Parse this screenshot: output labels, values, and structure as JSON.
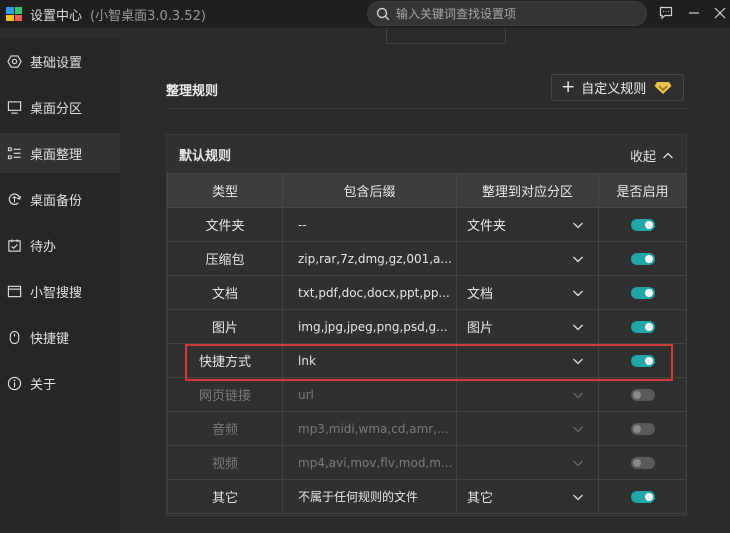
{
  "titlebar": {
    "title": "设置中心",
    "version": "(小智桌面3.0.3.52)",
    "search_placeholder": "输入关键词查找设置项",
    "logo_colors": [
      "#2b9cf2",
      "#38c86a",
      "#f5c020",
      "#f25c4a"
    ]
  },
  "sidebar": {
    "items": [
      {
        "label": "基础设置",
        "icon": "hexagon-settings-icon"
      },
      {
        "label": "桌面分区",
        "icon": "monitor-icon"
      },
      {
        "label": "桌面整理",
        "icon": "list-organize-icon",
        "active": true
      },
      {
        "label": "桌面备份",
        "icon": "backup-icon"
      },
      {
        "label": "待办",
        "icon": "calendar-check-icon"
      },
      {
        "label": "小智搜搜",
        "icon": "window-search-icon"
      },
      {
        "label": "快捷键",
        "icon": "mouse-icon"
      },
      {
        "label": "关于",
        "icon": "info-icon"
      }
    ]
  },
  "main": {
    "section_title": "整理规则",
    "custom_rule_button": "自定义规则",
    "panel_title": "默认规则",
    "collapse_label": "收起",
    "columns": [
      "类型",
      "包含后缀",
      "整理到对应分区",
      "是否启用"
    ],
    "rows": [
      {
        "type": "文件夹",
        "suffix": "--",
        "partition": "文件夹",
        "enabled": true
      },
      {
        "type": "压缩包",
        "suffix": "zip,rar,7z,dmg,gz,001,a...",
        "partition": "",
        "enabled": true
      },
      {
        "type": "文档",
        "suffix": "txt,pdf,doc,docx,ppt,pp...",
        "partition": "文档",
        "enabled": true
      },
      {
        "type": "图片",
        "suffix": "img,jpg,jpeg,png,psd,g...",
        "partition": "图片",
        "enabled": true
      },
      {
        "type": "快捷方式",
        "suffix": "lnk",
        "partition": "",
        "enabled": true
      },
      {
        "type": "网页链接",
        "suffix": "url",
        "partition": "",
        "enabled": false
      },
      {
        "type": "音频",
        "suffix": "mp3,midi,wma,cd,amr,...",
        "partition": "",
        "enabled": false
      },
      {
        "type": "视频",
        "suffix": "mp4,avi,mov,flv,mod,m...",
        "partition": "",
        "enabled": false
      },
      {
        "type": "其它",
        "suffix": "不属于任何规则的文件",
        "partition": "其它",
        "enabled": true
      }
    ],
    "accent_color": "#21a6a6",
    "highlight_color": "#d33a3a"
  }
}
